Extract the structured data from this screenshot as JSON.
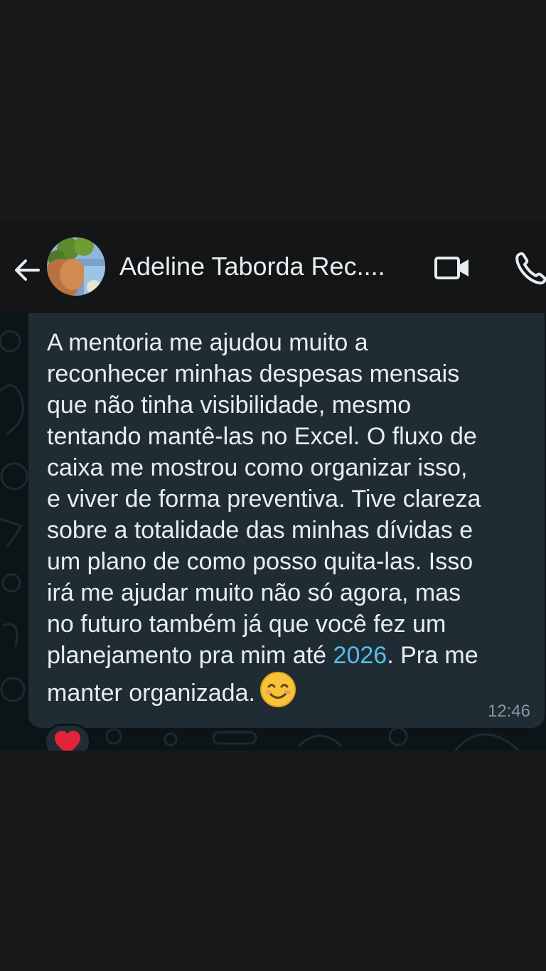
{
  "header": {
    "contact_name": "Adeline Taborda Rec....",
    "back_icon": "arrow-left-icon",
    "video_icon": "video-camera-icon",
    "call_icon": "phone-icon"
  },
  "message": {
    "text_before_link": "A mentoria me ajudou muito a\nreconhecer minhas despesas mensais\nque não tinha visibilidade, mesmo\ntentando mantê-las no Excel. O fluxo de\ncaixa me mostrou como organizar isso,\ne viver de forma preventiva. Tive clareza\nsobre a totalidade das minhas dívidas e\num plano de como posso quita-las. Isso\nirá me ajudar muito não só agora, mas\nno futuro também já que você fez um\nplanejamento pra mim até ",
    "link_text": "2026",
    "text_after_link": ". Pra me\nmanter organizada.",
    "emoji": "smiling-face-icon",
    "time": "12:46",
    "reaction": "red-heart-icon"
  },
  "colors": {
    "bubble": "#202c33",
    "link": "#53bdeb",
    "text": "#e9edef",
    "time": "#8696a0"
  }
}
